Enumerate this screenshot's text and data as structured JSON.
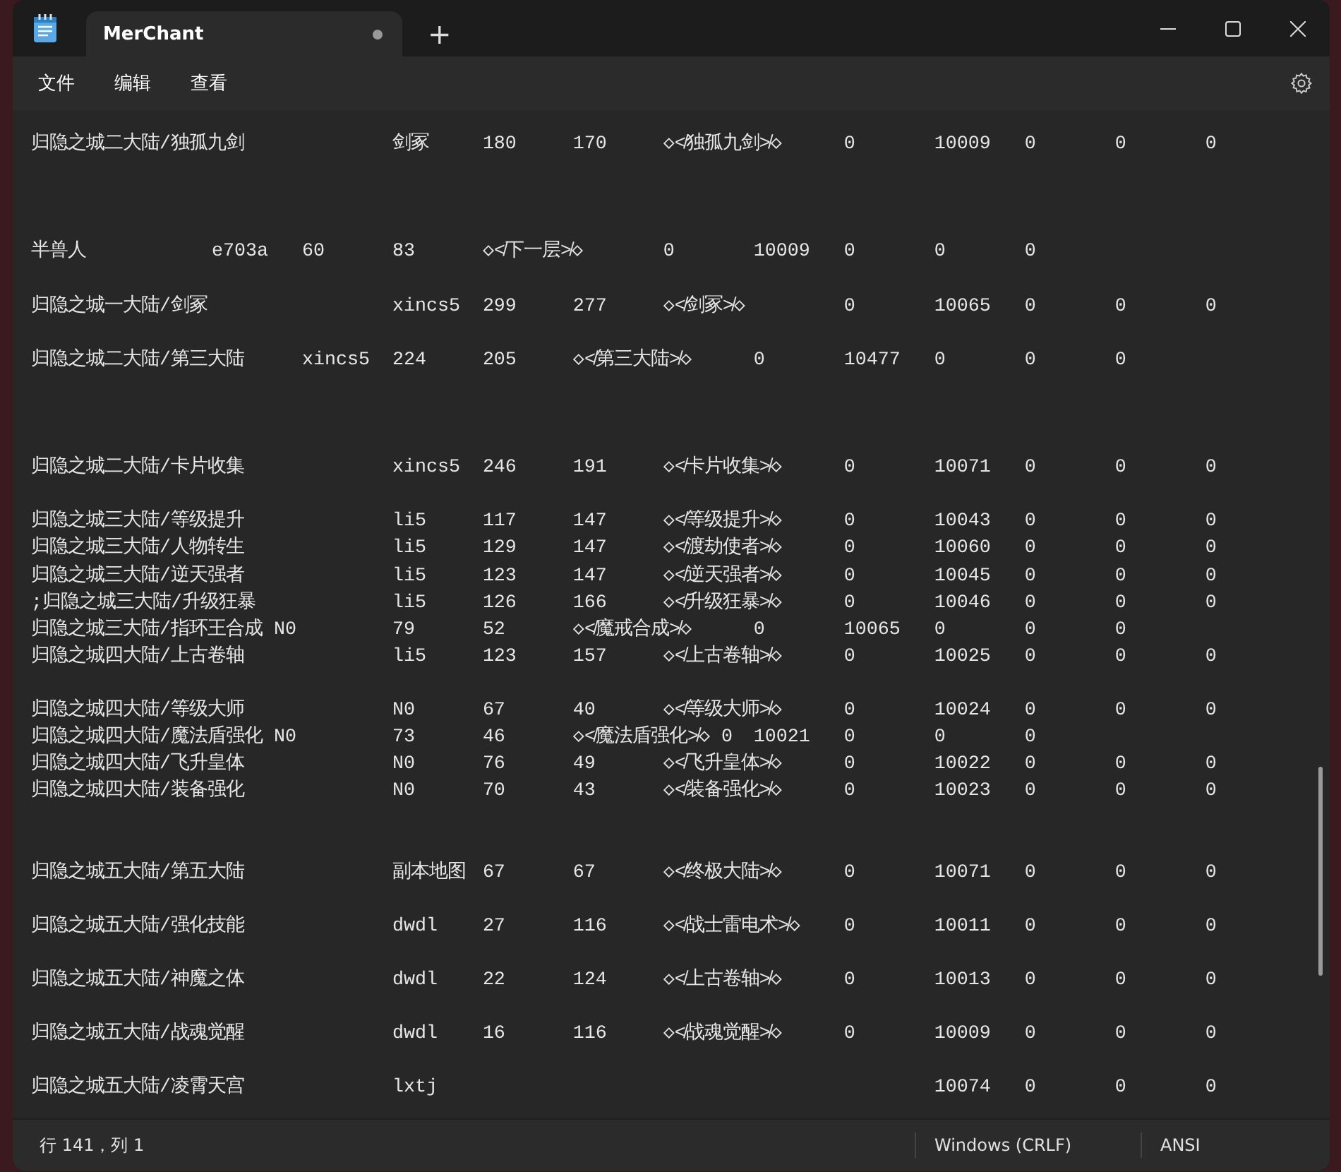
{
  "window": {
    "tabs": [
      {
        "title": "MerChant",
        "selected": true,
        "modified": true
      }
    ],
    "new_tab_button": "+"
  },
  "menu": [
    "文件",
    "编辑",
    "查看"
  ],
  "editor": {
    "lines": [
      {
        "kind": "text",
        "text": "归隐之城二大陆/独孤九剑\t\t剑冢\t180\t170\t◇≮独孤九剑≯◇\t0\t10009\t0\t0\t0"
      },
      {
        "kind": "blank"
      },
      {
        "kind": "blank"
      },
      {
        "kind": "blank"
      },
      {
        "kind": "text",
        "text": "半兽人\t\te703a\t60\t83\t◇≮下一层≯◇\t0\t10009\t0\t0\t0"
      },
      {
        "kind": "blank"
      },
      {
        "kind": "text",
        "text": "归隐之城一大陆/剑冢\t\txincs5\t299\t277\t◇≮剑冢≯◇\t\t0\t10065\t0\t0\t0"
      },
      {
        "kind": "blank"
      },
      {
        "kind": "text",
        "text": "归隐之城二大陆/第三大陆\txincs5\t224\t205\t◇≮第三大陆≯◇\t0\t10477\t0\t0\t0"
      },
      {
        "kind": "blank"
      },
      {
        "kind": "blank"
      },
      {
        "kind": "blank"
      },
      {
        "kind": "text",
        "text": "归隐之城二大陆/卡片收集\t\txincs5\t246\t191\t◇≮卡片收集≯◇\t0\t10071\t0\t0\t0"
      },
      {
        "kind": "blank"
      },
      {
        "kind": "text",
        "text": "归隐之城三大陆/等级提升\t\tli5\t117\t147\t◇≮等级提升≯◇\t0\t10043\t0\t0\t0"
      },
      {
        "kind": "text",
        "text": "归隐之城三大陆/人物转生\t\tli5\t129\t147\t◇≮渡劫使者≯◇\t0\t10060\t0\t0\t0"
      },
      {
        "kind": "text",
        "text": "归隐之城三大陆/逆天强者\t\tli5\t123\t147\t◇≮逆天强者≯◇\t0\t10045\t0\t0\t0"
      },
      {
        "kind": "text",
        "text": ";归隐之城三大陆/升级狂暴\t\tli5\t126\t166\t◇≮升级狂暴≯◇\t0\t10046\t0\t0\t0"
      },
      {
        "kind": "text",
        "text": "归隐之城三大陆/指环王合成 N0\t79\t52\t◇≮魔戒合成≯◇\t0\t10065\t0\t0\t0"
      },
      {
        "kind": "text",
        "text": "归隐之城四大陆/上古卷轴\t\tli5\t123\t157\t◇≮上古卷轴≯◇\t0\t10025\t0\t0\t0"
      },
      {
        "kind": "blank"
      },
      {
        "kind": "text",
        "text": "归隐之城四大陆/等级大师\t\tN0\t67\t40\t◇≮等级大师≯◇\t0\t10024\t0\t0\t0"
      },
      {
        "kind": "text",
        "text": "归隐之城四大陆/魔法盾强化 N0\t73\t46\t◇≮魔法盾强化≯◇ 0\t10021\t0\t0\t0"
      },
      {
        "kind": "text",
        "text": "归隐之城四大陆/飞升皇体\t\tN0\t76\t49\t◇≮飞升皇体≯◇\t0\t10022\t0\t0\t0"
      },
      {
        "kind": "text",
        "text": "归隐之城四大陆/装备强化\t\tN0\t70\t43\t◇≮装备强化≯◇\t0\t10023\t0\t0\t0"
      },
      {
        "kind": "blank"
      },
      {
        "kind": "blank"
      },
      {
        "kind": "text",
        "text": "归隐之城五大陆/第五大陆\t\t副本地图\t67\t67\t◇≮终极大陆≯◇\t0\t10071\t0\t0\t0"
      },
      {
        "kind": "blank"
      },
      {
        "kind": "text",
        "text": "归隐之城五大陆/强化技能\t\tdwdl\t27\t116\t◇≮战士雷电术≯◇\t0\t10011\t0\t0\t0"
      },
      {
        "kind": "blank"
      },
      {
        "kind": "text",
        "text": "归隐之城五大陆/神魔之体\t\tdwdl\t22\t124\t◇≮上古卷轴≯◇\t0\t10013\t0\t0\t0"
      },
      {
        "kind": "blank"
      },
      {
        "kind": "text",
        "text": "归隐之城五大陆/战魂觉醒\t\tdwdl\t16\t116\t◇≮战魂觉醒≯◇\t0\t10009\t0\t0\t0"
      },
      {
        "kind": "blank"
      },
      {
        "kind": "text",
        "text": "归隐之城五大陆/凌霄天宫\t\tlxtj\t\t\t\t\t\t10074\t0\t0\t0"
      }
    ]
  },
  "status_bar": {
    "position": "行 141，列 1",
    "line_ending": "Windows (CRLF)",
    "encoding": "ANSI"
  }
}
